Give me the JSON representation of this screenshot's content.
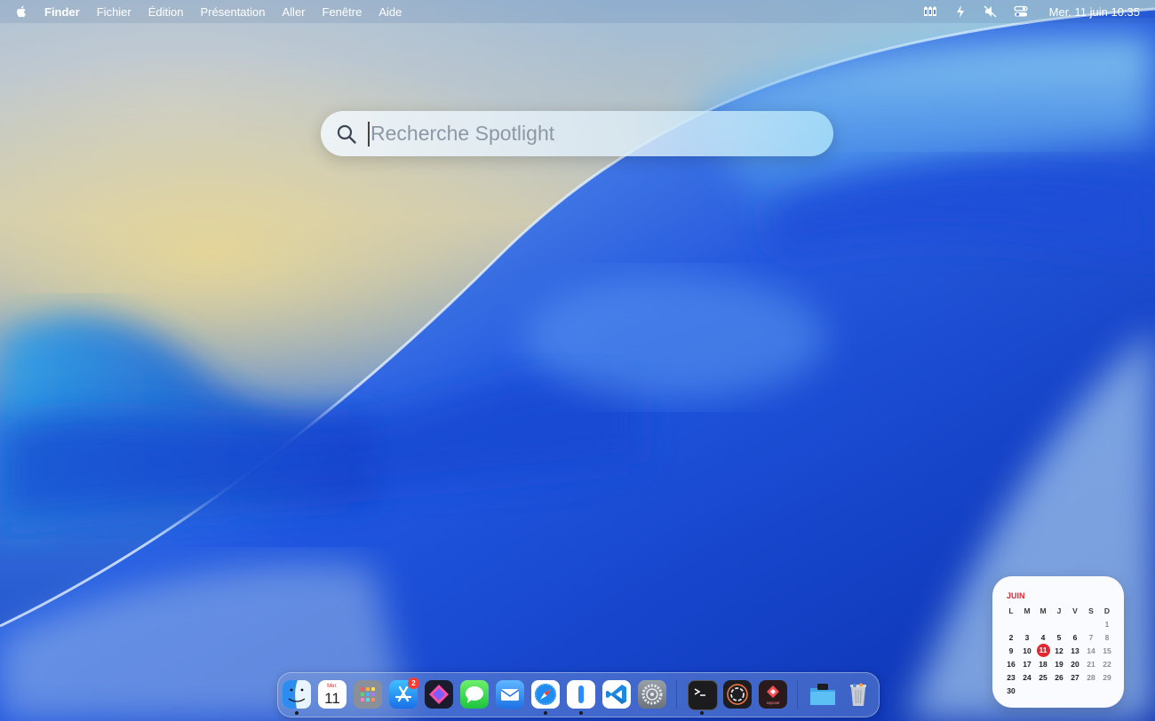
{
  "menubar": {
    "app_name": "Finder",
    "menus": [
      "Fichier",
      "Édition",
      "Présentation",
      "Aller",
      "Fenêtre",
      "Aide"
    ],
    "clock": "Mer. 11 juin  10:35",
    "status_icons": [
      "cast-icon",
      "battery-charging-icon",
      "mute-icon",
      "control-center-icon"
    ]
  },
  "spotlight": {
    "placeholder": "Recherche Spotlight",
    "value": ""
  },
  "calendar_widget": {
    "month": "JUIN",
    "weekdays": [
      "L",
      "M",
      "M",
      "J",
      "V",
      "S",
      "D"
    ],
    "today": "11",
    "weeks": [
      [
        "",
        "",
        "",
        "",
        "",
        "",
        "1"
      ],
      [
        "2",
        "3",
        "4",
        "5",
        "6",
        "7",
        "8"
      ],
      [
        "9",
        "10",
        "11",
        "12",
        "13",
        "14",
        "15"
      ],
      [
        "16",
        "17",
        "18",
        "19",
        "20",
        "21",
        "22"
      ],
      [
        "23",
        "24",
        "25",
        "26",
        "27",
        "28",
        "29"
      ],
      [
        "30",
        "",
        "",
        "",
        "",
        "",
        ""
      ]
    ]
  },
  "dock": {
    "calendar_icon_day_label": "Mer.",
    "calendar_icon_date": "11",
    "app_store_badge": "2",
    "raycast_label": "raycast",
    "apps": [
      {
        "name": "Finder",
        "running": true
      },
      {
        "name": "Calendrier",
        "running": false
      },
      {
        "name": "Launchpad",
        "running": false
      },
      {
        "name": "App Store",
        "running": false
      },
      {
        "name": "Raccourcis",
        "running": false
      },
      {
        "name": "Messages",
        "running": false
      },
      {
        "name": "Mail",
        "running": false
      },
      {
        "name": "Safari",
        "running": true
      },
      {
        "name": "Notes",
        "running": true
      },
      {
        "name": "Visual Studio Code",
        "running": false
      },
      {
        "name": "Réglages Système",
        "running": false
      },
      {
        "name": "Terminal",
        "running": true
      },
      {
        "name": "ChatGPT",
        "running": false
      },
      {
        "name": "Raycast",
        "running": false
      },
      {
        "name": "Téléchargements",
        "running": false
      },
      {
        "name": "Corbeille",
        "running": false
      }
    ]
  }
}
